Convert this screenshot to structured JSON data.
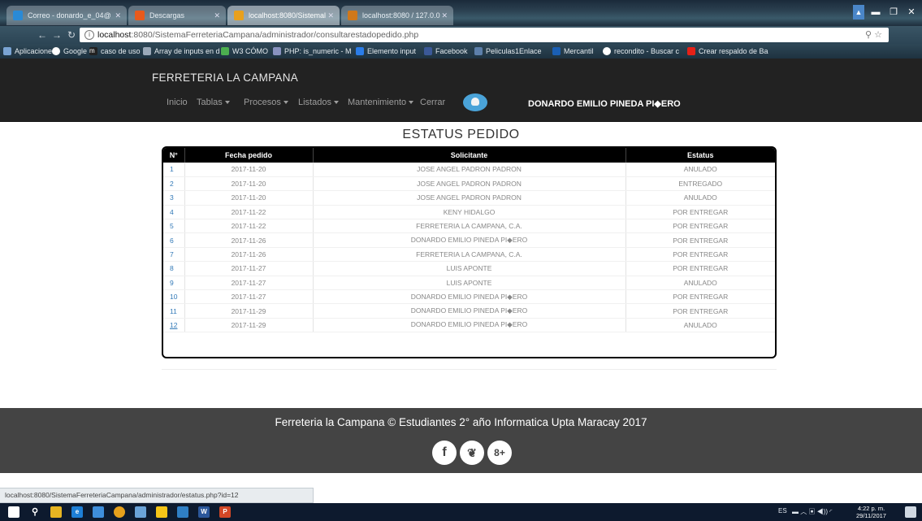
{
  "browser": {
    "tabs": [
      {
        "label": "Correo - donardo_e_04@",
        "icon_color": "#2a8ad6",
        "active": false
      },
      {
        "label": "Descargas",
        "icon_color": "#e85a1c",
        "active": false
      },
      {
        "label": "localhost:8080/Sistemal",
        "icon_color": "#e8a01c",
        "active": true
      },
      {
        "label": "localhost:8080 / 127.0.0",
        "icon_color": "#d0781a",
        "active": false
      }
    ],
    "window_controls": [
      "▬",
      "❐",
      "✕"
    ],
    "address": {
      "host": "localhost",
      "path": ":8080/SistemaFerreteriaCampana/administrador/consultarestadopedido.php"
    },
    "bookmarks": [
      {
        "label": "Aplicaciones",
        "color": "#7aa4d4"
      },
      {
        "label": "Google",
        "color": "#ffffff"
      },
      {
        "label": "caso de uso",
        "color": "#222222"
      },
      {
        "label": "Array de inputs en d",
        "color": "#9aa8b8"
      },
      {
        "label": "W3 CÓMO",
        "color": "#4caf50"
      },
      {
        "label": "PHP: is_numeric - M",
        "color": "#8892bf"
      },
      {
        "label": "Elemento input",
        "color": "#2b7de9"
      },
      {
        "label": "Facebook",
        "color": "#3b5998"
      },
      {
        "label": "Peliculas1Enlace",
        "color": "#5c7faa"
      },
      {
        "label": "Mercantil",
        "color": "#1a5fb4"
      },
      {
        "label": "recondito - Buscar c",
        "color": "#ffffff"
      },
      {
        "label": "Crear respaldo de Ba",
        "color": "#e62117"
      }
    ]
  },
  "site": {
    "brand": "FERRETERIA LA CAMPANA",
    "menu": [
      {
        "label": "Inicio",
        "dropdown": false
      },
      {
        "label": "Tablas",
        "dropdown": true
      },
      {
        "label": "Procesos",
        "dropdown": true
      },
      {
        "label": "Listados",
        "dropdown": true
      },
      {
        "label": "Mantenimiento",
        "dropdown": true
      },
      {
        "label": "Cerrar",
        "dropdown": false
      }
    ],
    "user_name": "DONARDO EMILIO PINEDA PI◆ERO"
  },
  "page": {
    "title": "ESTATUS PEDIDO",
    "table": {
      "headers": [
        "N°",
        "Fecha pedido",
        "Solicitante",
        "Estatus"
      ],
      "rows": [
        [
          "1",
          "2017-11-20",
          "JOSE ANGEL PADRON PADRON",
          "ANULADO"
        ],
        [
          "2",
          "2017-11-20",
          "JOSE ANGEL PADRON PADRON",
          "ENTREGADO"
        ],
        [
          "3",
          "2017-11-20",
          "JOSE ANGEL PADRON PADRON",
          "ANULADO"
        ],
        [
          "4",
          "2017-11-22",
          "KENY HIDALGO",
          "POR ENTREGAR"
        ],
        [
          "5",
          "2017-11-22",
          "FERRETERIA LA CAMPANA, C.A.",
          "POR ENTREGAR"
        ],
        [
          "6",
          "2017-11-26",
          "DONARDO EMILIO PINEDA PI◆ERO",
          "POR ENTREGAR"
        ],
        [
          "7",
          "2017-11-26",
          "FERRETERIA LA CAMPANA, C.A.",
          "POR ENTREGAR"
        ],
        [
          "8",
          "2017-11-27",
          "LUIS APONTE",
          "POR ENTREGAR"
        ],
        [
          "9",
          "2017-11-27",
          "LUIS APONTE",
          "ANULADO"
        ],
        [
          "10",
          "2017-11-27",
          "DONARDO EMILIO PINEDA PI◆ERO",
          "POR ENTREGAR"
        ],
        [
          "11",
          "2017-11-29",
          "DONARDO EMILIO PINEDA PI◆ERO",
          "POR ENTREGAR"
        ],
        [
          "12",
          "2017-11-29",
          "DONARDO EMILIO PINEDA PI◆ERO",
          "ANULADO"
        ]
      ]
    }
  },
  "footer": {
    "text": "Ferreteria la Campana © Estudiantes 2° año Informatica Upta Maracay 2017",
    "social": [
      {
        "name": "facebook",
        "glyph": "f"
      },
      {
        "name": "twitter",
        "glyph": "❦"
      },
      {
        "name": "google-plus",
        "glyph": "8+"
      }
    ]
  },
  "status_url": "localhost:8080/SistemaFerreteriaCampana/administrador/estatus.php?id=12",
  "taskbar": {
    "language": "ES",
    "time": "4:22 p. m.",
    "date": "29/11/2017"
  }
}
